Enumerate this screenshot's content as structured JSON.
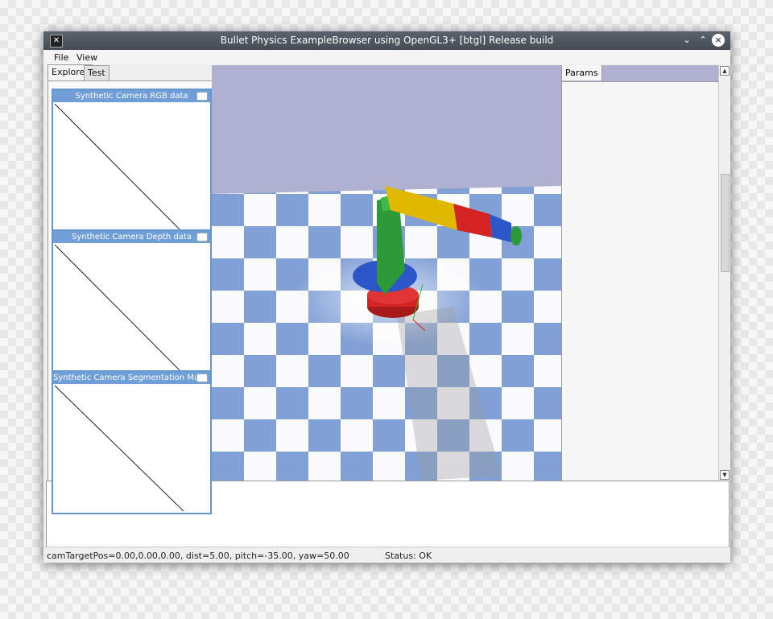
{
  "window": {
    "title": "Bullet Physics ExampleBrowser using OpenGL3+ [btgl] Release build",
    "controls": {
      "minimize": "⌄",
      "maximize": "⌃",
      "close": "×"
    }
  },
  "menu": {
    "items": [
      "File",
      "View"
    ]
  },
  "left_tabs": [
    {
      "label": "Explorer",
      "active": true
    },
    {
      "label": "Test",
      "active": false
    }
  ],
  "camera_windows": [
    {
      "title": "Synthetic Camera RGB data"
    },
    {
      "title": "Synthetic Camera Depth data"
    },
    {
      "title": "Synthetic Camera Segmentation Mask"
    }
  ],
  "params": {
    "tab_label": "Params"
  },
  "status": {
    "camera": "camTargetPos=0.00,0.00,0.00, dist=5.00, pitch=-35.00, yaw=50.00",
    "state": "Status: OK"
  },
  "colors": {
    "sky": "#b0b0d0",
    "floor_light": "#ffffff",
    "floor_blue": "#7f9fd6",
    "robot_red": "#d42323",
    "robot_blue": "#2d57c8",
    "robot_green": "#2d9a3a",
    "robot_yellow": "#e0b800",
    "cam_header": "#6f9fd6"
  }
}
